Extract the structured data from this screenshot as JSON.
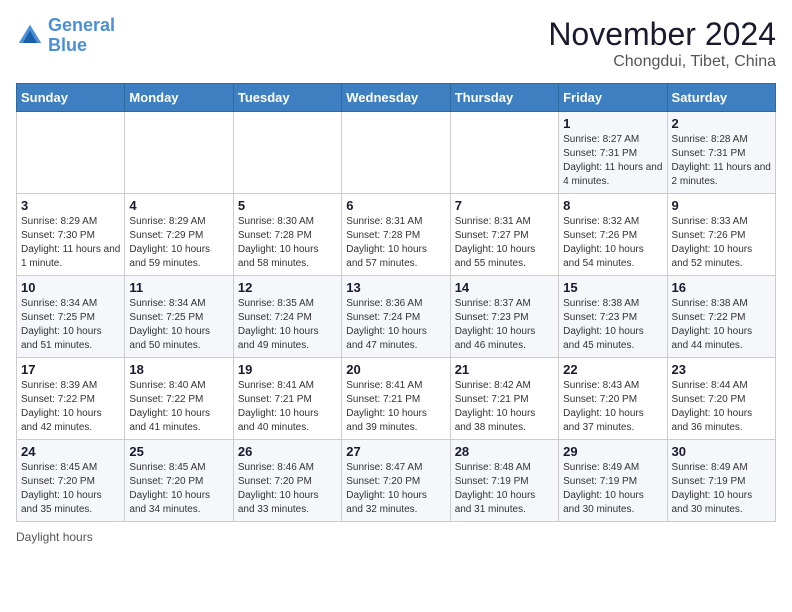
{
  "header": {
    "logo_line1": "General",
    "logo_line2": "Blue",
    "main_title": "November 2024",
    "subtitle": "Chongdui, Tibet, China"
  },
  "days_of_week": [
    "Sunday",
    "Monday",
    "Tuesday",
    "Wednesday",
    "Thursday",
    "Friday",
    "Saturday"
  ],
  "weeks": [
    [
      {
        "day": "",
        "info": ""
      },
      {
        "day": "",
        "info": ""
      },
      {
        "day": "",
        "info": ""
      },
      {
        "day": "",
        "info": ""
      },
      {
        "day": "",
        "info": ""
      },
      {
        "day": "1",
        "info": "Sunrise: 8:27 AM\nSunset: 7:31 PM\nDaylight: 11 hours and 4 minutes."
      },
      {
        "day": "2",
        "info": "Sunrise: 8:28 AM\nSunset: 7:31 PM\nDaylight: 11 hours and 2 minutes."
      }
    ],
    [
      {
        "day": "3",
        "info": "Sunrise: 8:29 AM\nSunset: 7:30 PM\nDaylight: 11 hours and 1 minute."
      },
      {
        "day": "4",
        "info": "Sunrise: 8:29 AM\nSunset: 7:29 PM\nDaylight: 10 hours and 59 minutes."
      },
      {
        "day": "5",
        "info": "Sunrise: 8:30 AM\nSunset: 7:28 PM\nDaylight: 10 hours and 58 minutes."
      },
      {
        "day": "6",
        "info": "Sunrise: 8:31 AM\nSunset: 7:28 PM\nDaylight: 10 hours and 57 minutes."
      },
      {
        "day": "7",
        "info": "Sunrise: 8:31 AM\nSunset: 7:27 PM\nDaylight: 10 hours and 55 minutes."
      },
      {
        "day": "8",
        "info": "Sunrise: 8:32 AM\nSunset: 7:26 PM\nDaylight: 10 hours and 54 minutes."
      },
      {
        "day": "9",
        "info": "Sunrise: 8:33 AM\nSunset: 7:26 PM\nDaylight: 10 hours and 52 minutes."
      }
    ],
    [
      {
        "day": "10",
        "info": "Sunrise: 8:34 AM\nSunset: 7:25 PM\nDaylight: 10 hours and 51 minutes."
      },
      {
        "day": "11",
        "info": "Sunrise: 8:34 AM\nSunset: 7:25 PM\nDaylight: 10 hours and 50 minutes."
      },
      {
        "day": "12",
        "info": "Sunrise: 8:35 AM\nSunset: 7:24 PM\nDaylight: 10 hours and 49 minutes."
      },
      {
        "day": "13",
        "info": "Sunrise: 8:36 AM\nSunset: 7:24 PM\nDaylight: 10 hours and 47 minutes."
      },
      {
        "day": "14",
        "info": "Sunrise: 8:37 AM\nSunset: 7:23 PM\nDaylight: 10 hours and 46 minutes."
      },
      {
        "day": "15",
        "info": "Sunrise: 8:38 AM\nSunset: 7:23 PM\nDaylight: 10 hours and 45 minutes."
      },
      {
        "day": "16",
        "info": "Sunrise: 8:38 AM\nSunset: 7:22 PM\nDaylight: 10 hours and 44 minutes."
      }
    ],
    [
      {
        "day": "17",
        "info": "Sunrise: 8:39 AM\nSunset: 7:22 PM\nDaylight: 10 hours and 42 minutes."
      },
      {
        "day": "18",
        "info": "Sunrise: 8:40 AM\nSunset: 7:22 PM\nDaylight: 10 hours and 41 minutes."
      },
      {
        "day": "19",
        "info": "Sunrise: 8:41 AM\nSunset: 7:21 PM\nDaylight: 10 hours and 40 minutes."
      },
      {
        "day": "20",
        "info": "Sunrise: 8:41 AM\nSunset: 7:21 PM\nDaylight: 10 hours and 39 minutes."
      },
      {
        "day": "21",
        "info": "Sunrise: 8:42 AM\nSunset: 7:21 PM\nDaylight: 10 hours and 38 minutes."
      },
      {
        "day": "22",
        "info": "Sunrise: 8:43 AM\nSunset: 7:20 PM\nDaylight: 10 hours and 37 minutes."
      },
      {
        "day": "23",
        "info": "Sunrise: 8:44 AM\nSunset: 7:20 PM\nDaylight: 10 hours and 36 minutes."
      }
    ],
    [
      {
        "day": "24",
        "info": "Sunrise: 8:45 AM\nSunset: 7:20 PM\nDaylight: 10 hours and 35 minutes."
      },
      {
        "day": "25",
        "info": "Sunrise: 8:45 AM\nSunset: 7:20 PM\nDaylight: 10 hours and 34 minutes."
      },
      {
        "day": "26",
        "info": "Sunrise: 8:46 AM\nSunset: 7:20 PM\nDaylight: 10 hours and 33 minutes."
      },
      {
        "day": "27",
        "info": "Sunrise: 8:47 AM\nSunset: 7:20 PM\nDaylight: 10 hours and 32 minutes."
      },
      {
        "day": "28",
        "info": "Sunrise: 8:48 AM\nSunset: 7:19 PM\nDaylight: 10 hours and 31 minutes."
      },
      {
        "day": "29",
        "info": "Sunrise: 8:49 AM\nSunset: 7:19 PM\nDaylight: 10 hours and 30 minutes."
      },
      {
        "day": "30",
        "info": "Sunrise: 8:49 AM\nSunset: 7:19 PM\nDaylight: 10 hours and 30 minutes."
      }
    ]
  ],
  "footer": {
    "daylight_label": "Daylight hours"
  }
}
